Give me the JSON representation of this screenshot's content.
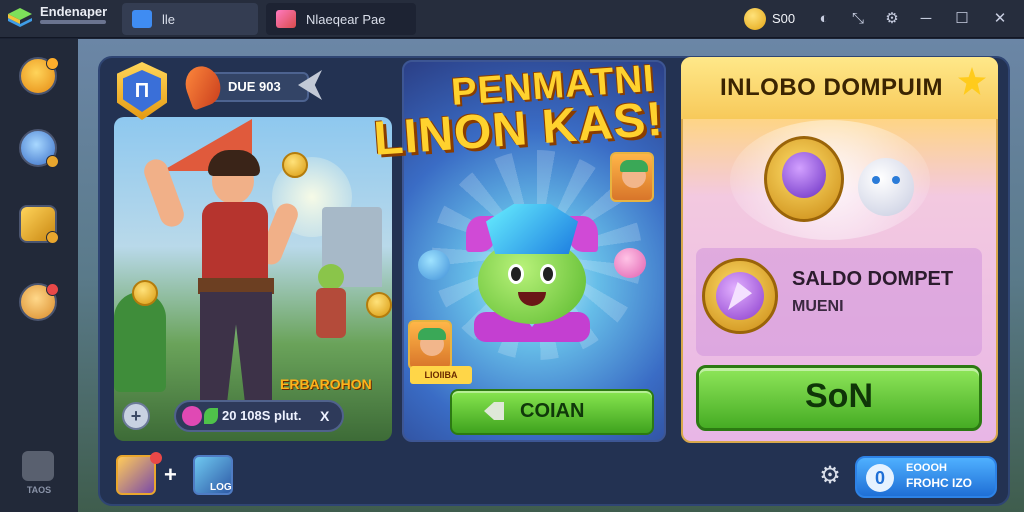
{
  "titlebar": {
    "app_name": "Endenaper",
    "tabs": [
      {
        "label": "lle",
        "icon": "home-icon"
      },
      {
        "label": "Nlaeqear Pae",
        "icon": "game-icon"
      }
    ],
    "coin_value": "S00",
    "icons": [
      "coin-icon",
      "account-icon",
      "collapse-icon",
      "settings-icon",
      "minimize-icon",
      "maximize-icon",
      "close-icon"
    ]
  },
  "sidebar": {
    "items": [
      {
        "icon": "emoji-icon"
      },
      {
        "icon": "avatar-icon"
      },
      {
        "icon": "chest-icon"
      },
      {
        "icon": "scroll-icon"
      }
    ],
    "bottom_label": "TAOS"
  },
  "left_card": {
    "level": "Π",
    "ribbon_text": "DUE 903",
    "caption": "ERBAROHON",
    "pill_text": "20 108S plut.",
    "pill_x": "X",
    "plus_label": "+"
  },
  "promo": {
    "title_line1": "PENMATNI",
    "title_line2": "LINON KAS!",
    "card_label": "LIOIIBA",
    "claim_label": "COIAN"
  },
  "right_card": {
    "title": "INLOBO DOMPUIM",
    "balance_title": "SALDO DOMPET",
    "balance_sub": "MUENI",
    "button_label": "SoN"
  },
  "bottom_bar": {
    "plus": "+",
    "slot_label": "LOG",
    "pill_circle": "0",
    "pill_line1": "EOOOH",
    "pill_line2": "FROHC IZO"
  },
  "colors": {
    "accent_gold": "#ffd22e",
    "button_green": "#46ac24",
    "pill_blue": "#1f6fd6"
  }
}
